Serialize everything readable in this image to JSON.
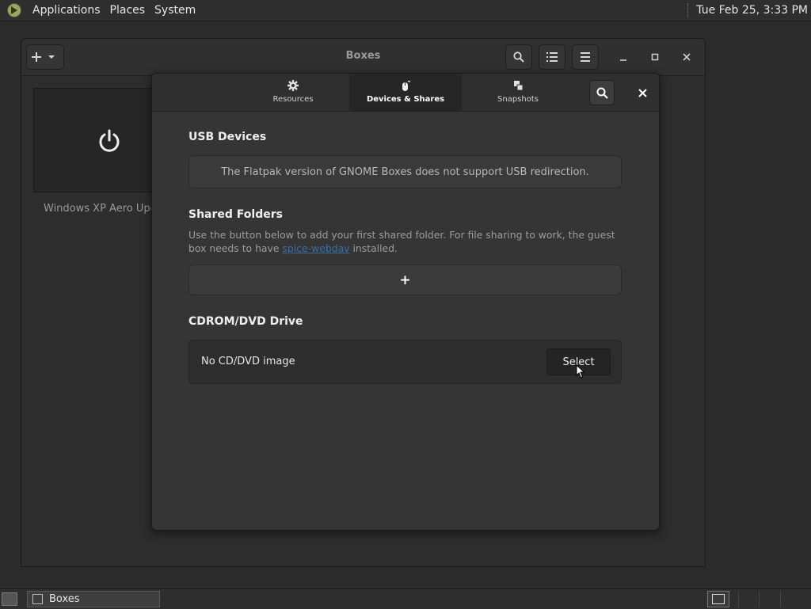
{
  "top_panel": {
    "menus": [
      "Applications",
      "Places",
      "System"
    ],
    "clock": "Tue Feb 25,  3:33 PM"
  },
  "window": {
    "title": "Boxes",
    "vm_name": "Windows XP Aero Upda"
  },
  "dialog": {
    "tabs": [
      {
        "label": "Resources",
        "icon": "gear-icon"
      },
      {
        "label": "Devices & Shares",
        "icon": "mouse-icon",
        "active": true
      },
      {
        "label": "Snapshots",
        "icon": "snapshots-icon"
      }
    ],
    "usb": {
      "title": "USB Devices",
      "message": "The Flatpak version of GNOME Boxes does not support USB redirection."
    },
    "shared": {
      "title": "Shared Folders",
      "desc_before": "Use the button below to add your first shared folder. For file sharing to work, the guest box needs to have ",
      "link": "spice-webdav",
      "desc_after": " installed.",
      "add_label": "+"
    },
    "cdrom": {
      "title": "CDROM/DVD Drive",
      "status": "No CD/DVD image",
      "select_label": "Select"
    }
  },
  "taskbar": {
    "task_label": "Boxes"
  },
  "colors": {
    "accent_link": "#3d6ea3",
    "dialog_bg": "#353535",
    "panel_bg": "#2e2e2e"
  }
}
